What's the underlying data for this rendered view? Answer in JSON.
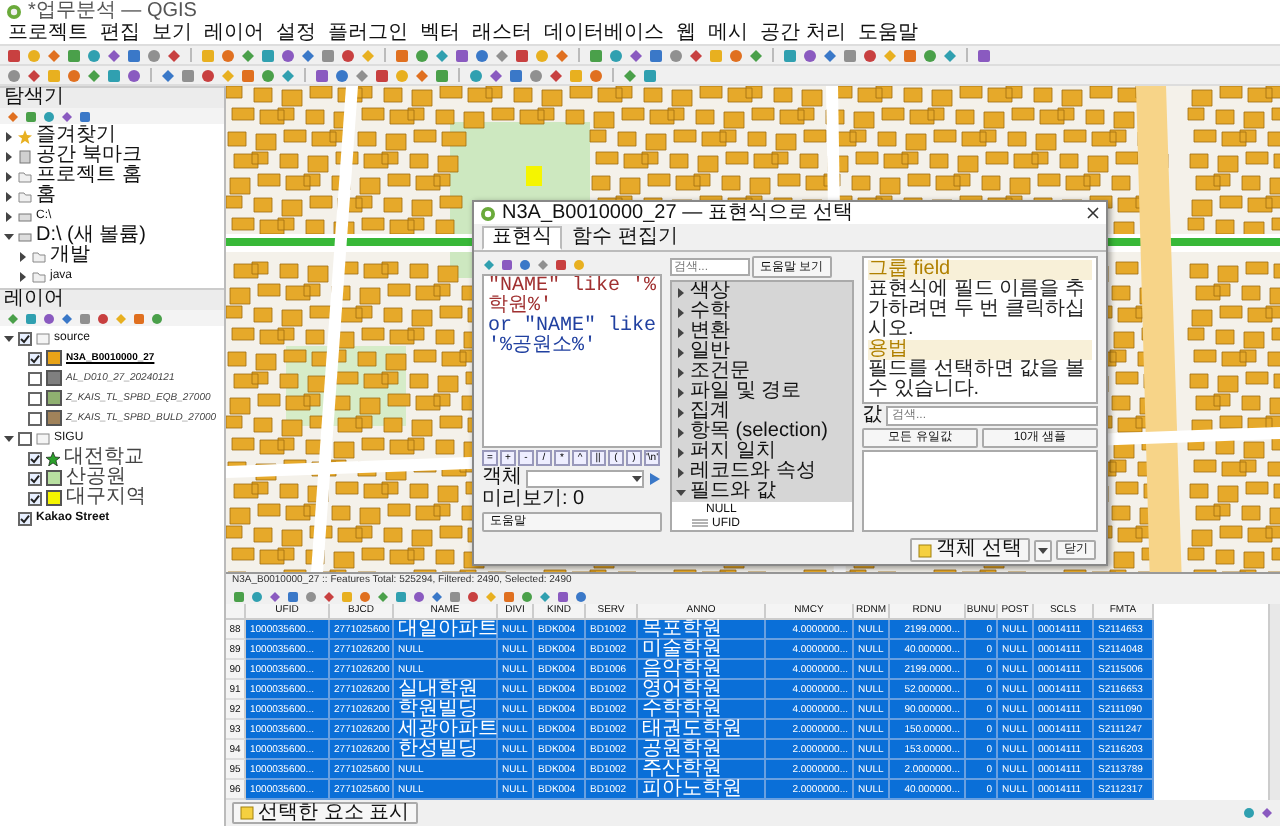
{
  "window": {
    "title": "*업무분석 — QGIS"
  },
  "menu": [
    "프로젝트",
    "편집",
    "보기",
    "레이어",
    "설정",
    "플러그인",
    "벡터",
    "래스터",
    "데이터베이스",
    "웹",
    "메시",
    "공간 처리",
    "도움말"
  ],
  "browser": {
    "title": "탐색기",
    "items": [
      {
        "label": "즐겨찾기",
        "kind": "star",
        "expanded": false
      },
      {
        "label": "공간 북마크",
        "kind": "bookmark",
        "expanded": false
      },
      {
        "label": "프로젝트 홈",
        "kind": "folder",
        "expanded": false
      },
      {
        "label": "홈",
        "kind": "folder",
        "expanded": false
      },
      {
        "label": "C:\\",
        "kind": "drive",
        "expanded": false
      },
      {
        "label": "D:\\ (새 볼륨)",
        "kind": "drive",
        "expanded": true,
        "children": [
          {
            "label": "개발",
            "kind": "folder",
            "expanded": false
          },
          {
            "label": "java",
            "kind": "folder",
            "expanded": false
          }
        ]
      }
    ]
  },
  "layers": {
    "title": "레이어",
    "tree": [
      {
        "label": "source",
        "kind": "group",
        "checked": true,
        "expanded": true,
        "children": [
          {
            "label": "N3A_B0010000_27",
            "kind": "layer",
            "checked": true,
            "active": true,
            "color": "#e8a317"
          },
          {
            "label": "AL_D010_27_20240121",
            "kind": "layer",
            "checked": false,
            "active": false,
            "color": "#7f7f7f"
          },
          {
            "label": "Z_KAIS_TL_SPBD_EQB_27000",
            "kind": "layer",
            "checked": false,
            "active": false,
            "color": "#8fb070"
          },
          {
            "label": "Z_KAIS_TL_SPBD_BULD_27000",
            "kind": "layer",
            "checked": false,
            "active": false,
            "color": "#a0825a"
          }
        ]
      },
      {
        "label": "SIGU",
        "kind": "group",
        "checked": false,
        "expanded": true,
        "children": [
          {
            "label": "대전학교",
            "kind": "point",
            "checked": true,
            "active": false,
            "color": "#2ca02c"
          },
          {
            "label": "산공원",
            "kind": "layer",
            "checked": true,
            "active": false,
            "color": "#b8e0a0"
          },
          {
            "label": "대구지역",
            "kind": "layer",
            "checked": true,
            "active": false,
            "color": "#f5f500"
          }
        ]
      },
      {
        "label": "Kakao Street",
        "kind": "tiles",
        "checked": true
      }
    ]
  },
  "dialog": {
    "title": "N3A_B0010000_27 — 표현식으로 선택",
    "tabs": [
      {
        "label": "표현식",
        "selected": true
      },
      {
        "label": "함수 편집기",
        "selected": false
      }
    ],
    "expression": [
      "\"NAME\" like '%학원%'",
      "or \"NAME\" like '%공원소%'"
    ],
    "operators": [
      "=",
      "+",
      "-",
      "/",
      "*",
      "^",
      "||",
      "(",
      ")",
      "'\\n'"
    ],
    "feature_label": "객체",
    "preview": "미리보기: 0",
    "help_button": "도움말",
    "search": {
      "placeholder": "검색..."
    },
    "show_help": "도움말 보기",
    "functions": [
      {
        "label": "색상",
        "kind": "group",
        "expanded": false
      },
      {
        "label": "수학",
        "kind": "group",
        "expanded": false
      },
      {
        "label": "변환",
        "kind": "group",
        "expanded": false
      },
      {
        "label": "일반",
        "kind": "group",
        "expanded": false
      },
      {
        "label": "조건문",
        "kind": "group",
        "expanded": false
      },
      {
        "label": "파일 및 경로",
        "kind": "group",
        "expanded": false
      },
      {
        "label": "집계",
        "kind": "group",
        "expanded": false
      },
      {
        "label": "항목 (selection)",
        "kind": "group",
        "expanded": false
      },
      {
        "label": "퍼지 일치",
        "kind": "group",
        "expanded": false
      },
      {
        "label": "레코드와 속성",
        "kind": "group",
        "expanded": false
      },
      {
        "label": "필드와 값",
        "kind": "group",
        "expanded": true
      },
      {
        "label": "NULL",
        "kind": "value"
      },
      {
        "label": "UFID",
        "kind": "text_field"
      }
    ],
    "help_title": "그룹 field",
    "help_text": "표현식에 필드 이름을 추가하려면 두 번 클릭하십시오.",
    "usage_title": "용법",
    "usage_text": "필드를 선택하면 값을 볼 수 있습니다.",
    "values_label": "값",
    "values_search": {
      "placeholder": "검색..."
    },
    "values_buttons": [
      "모든 유일값",
      "10개 샘플"
    ],
    "select_button": "객체 선택",
    "close_button": "닫기"
  },
  "attribute_table": {
    "title": "N3A_B0010000_27 :: Features Total: 525294, Filtered: 2490, Selected: 2490",
    "columns": [
      "UFID",
      "BJCD",
      "NAME",
      "DIVI",
      "KIND",
      "SERV",
      "ANNO",
      "NMCY",
      "RDNM",
      "RDNU",
      "BUNU",
      "POST",
      "SCLS",
      "FMTA"
    ],
    "rows": [
      {
        "num": "88",
        "selected": true,
        "cells": [
          "1000035600...",
          "2771025600",
          "대일아파트",
          "NULL",
          "BDK004",
          "BD1002",
          "목포학원",
          "4.0000000...",
          "NULL",
          "2199.0000...",
          "0",
          "NULL",
          "00014111",
          "S2114653"
        ]
      },
      {
        "num": "89",
        "selected": true,
        "cells": [
          "1000035600...",
          "2771026200",
          "NULL",
          "NULL",
          "BDK004",
          "BD1002",
          "미술학원",
          "4.0000000...",
          "NULL",
          "40.000000...",
          "0",
          "NULL",
          "00014111",
          "S2114048"
        ]
      },
      {
        "num": "90",
        "selected": true,
        "cells": [
          "1000035600...",
          "2771026200",
          "NULL",
          "NULL",
          "BDK004",
          "BD1006",
          "음악학원",
          "4.0000000...",
          "NULL",
          "2199.0000...",
          "0",
          "NULL",
          "00014111",
          "S2115006"
        ]
      },
      {
        "num": "91",
        "selected": true,
        "cells": [
          "1000035600...",
          "2771026200",
          "실내학원",
          "NULL",
          "BDK004",
          "BD1002",
          "영어학원",
          "4.0000000...",
          "NULL",
          "52.000000...",
          "0",
          "NULL",
          "00014111",
          "S2116653"
        ]
      },
      {
        "num": "92",
        "selected": true,
        "cells": [
          "1000035600...",
          "2771026200",
          "학원빌딩",
          "NULL",
          "BDK004",
          "BD1002",
          "수학학원",
          "4.0000000...",
          "NULL",
          "90.000000...",
          "0",
          "NULL",
          "00014111",
          "S2111090"
        ]
      },
      {
        "num": "93",
        "selected": true,
        "cells": [
          "1000035600...",
          "2771026200",
          "세광아파트",
          "NULL",
          "BDK004",
          "BD1002",
          "태권도학원",
          "2.0000000...",
          "NULL",
          "150.00000...",
          "0",
          "NULL",
          "00014111",
          "S2111247"
        ]
      },
      {
        "num": "94",
        "selected": true,
        "cells": [
          "1000035600...",
          "2771026200",
          "한성빌딩",
          "NULL",
          "BDK004",
          "BD1002",
          "공원학원",
          "2.0000000...",
          "NULL",
          "153.00000...",
          "0",
          "NULL",
          "00014111",
          "S2116203"
        ]
      },
      {
        "num": "95",
        "selected": true,
        "cells": [
          "1000035600...",
          "2771025600",
          "NULL",
          "NULL",
          "BDK004",
          "BD1002",
          "주산학원",
          "2.0000000...",
          "NULL",
          "2.0000000...",
          "0",
          "NULL",
          "00014111",
          "S2113789"
        ]
      },
      {
        "num": "96",
        "selected": true,
        "cells": [
          "1000035600...",
          "2771025600",
          "NULL",
          "NULL",
          "BDK004",
          "BD1002",
          "피아노학원",
          "2.0000000...",
          "NULL",
          "40.000000...",
          "0",
          "NULL",
          "00014111",
          "S2112317"
        ]
      }
    ],
    "show_button": "선택한 요소 표시"
  }
}
